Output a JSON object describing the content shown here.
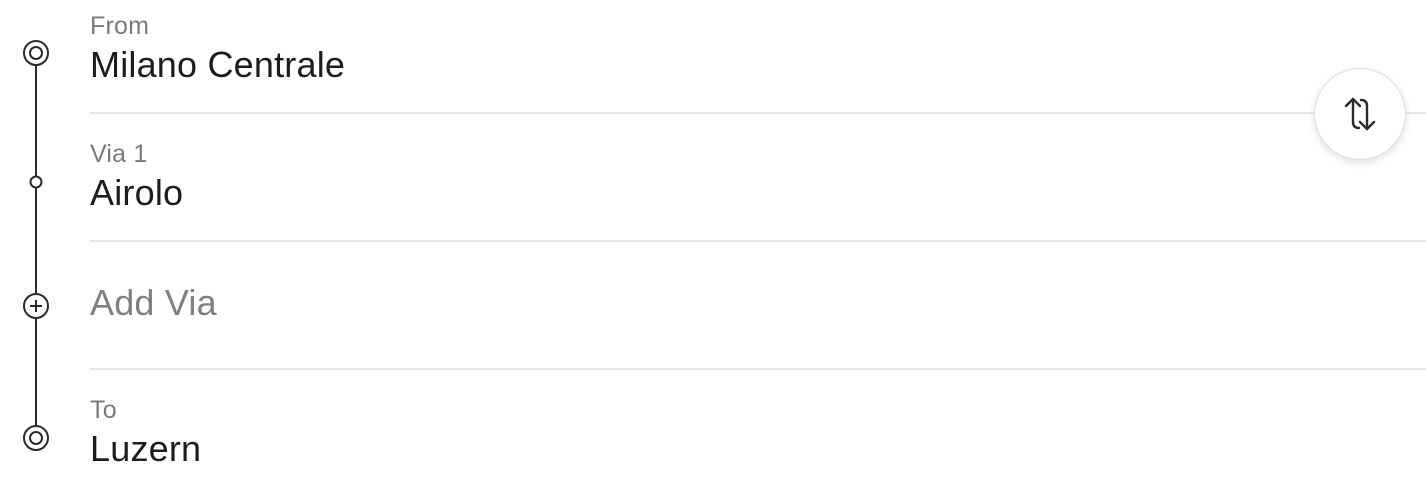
{
  "route": {
    "from": {
      "label": "From",
      "value": "Milano Centrale"
    },
    "via1": {
      "label": "Via 1",
      "value": "Airolo"
    },
    "add_via": {
      "placeholder": "Add Via"
    },
    "to": {
      "label": "To",
      "value": "Luzern"
    }
  },
  "icons": {
    "origin": "origin-stop-icon",
    "via": "via-stop-icon",
    "add": "add-via-icon",
    "destination": "destination-stop-icon",
    "swap": "swap-icon"
  },
  "colors": {
    "text": "#1c1c1c",
    "label": "#7a7a7a",
    "placeholder": "#808080",
    "divider": "#e6e6e6",
    "rail": "#2a2a2a"
  }
}
